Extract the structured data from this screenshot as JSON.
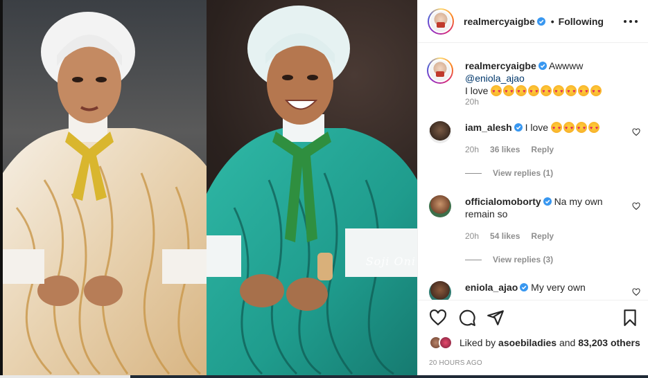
{
  "post": {
    "media": {
      "watermark": "Soji Oni",
      "left_photo": "woman in white turban and gold embellished gown",
      "right_photo": "woman in white turban and teal sequined gown"
    },
    "header": {
      "username": "realmercyaigbe",
      "separator": "•",
      "follow_status": "Following",
      "more_icon": "more-horizontal-icon"
    },
    "caption": {
      "username": "realmercyaigbe",
      "text": "Awwww",
      "mention": "@eniola_ajao",
      "text2": "I love",
      "emoji_count": 9,
      "time": "20h"
    },
    "comments": [
      {
        "username": "iam_alesh",
        "text": "I love",
        "emoji_count": 4,
        "time": "20h",
        "likes": "36 likes",
        "reply_label": "Reply",
        "view_replies": "View replies (1)"
      },
      {
        "username": "officialomoborty",
        "text": "Na my own remain so",
        "time": "20h",
        "likes": "54 likes",
        "reply_label": "Reply",
        "view_replies": "View replies (3)"
      },
      {
        "username": "eniola_ajao",
        "text": "My very own"
      }
    ],
    "actions": [
      "heart-icon",
      "comment-icon",
      "share-icon",
      "bookmark-icon"
    ],
    "likes": {
      "prefix": "Liked by",
      "user": "asoebiladies",
      "mid": "and",
      "others": "83,203 others"
    },
    "timestamp": "20 HOURS AGO"
  },
  "colors": {
    "text": "#262626",
    "muted": "#8e8e8e",
    "link": "#00376b",
    "verified": "#3897f0",
    "border": "#efefef"
  }
}
